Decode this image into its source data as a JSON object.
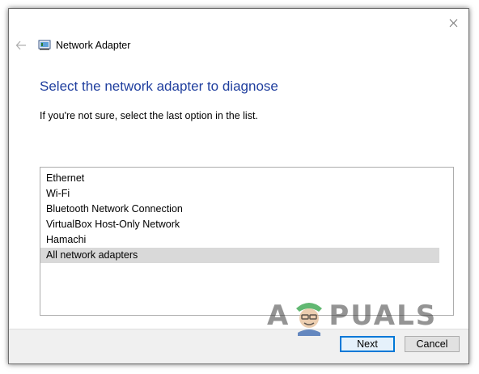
{
  "window": {
    "title": "Network Adapter",
    "close_icon": "close-icon",
    "back_icon": "back-arrow-icon",
    "adapter_icon": "network-adapter-icon"
  },
  "main": {
    "heading": "Select the network adapter to diagnose",
    "instruction": "If you're not sure, select the last option in the list."
  },
  "adapters": [
    {
      "label": "Ethernet",
      "selected": false
    },
    {
      "label": "Wi-Fi",
      "selected": false
    },
    {
      "label": "Bluetooth Network Connection",
      "selected": false
    },
    {
      "label": "VirtualBox Host-Only Network",
      "selected": false
    },
    {
      "label": "Hamachi",
      "selected": false
    },
    {
      "label": "All network adapters",
      "selected": true
    }
  ],
  "buttons": {
    "next": "Next",
    "cancel": "Cancel"
  },
  "watermark": {
    "part1": "A",
    "part2": "PUALS"
  },
  "colors": {
    "heading": "#1f3e9e",
    "selection": "#d9d9d9",
    "footer": "#f0f0f0",
    "default_button_border": "#0078d7"
  }
}
